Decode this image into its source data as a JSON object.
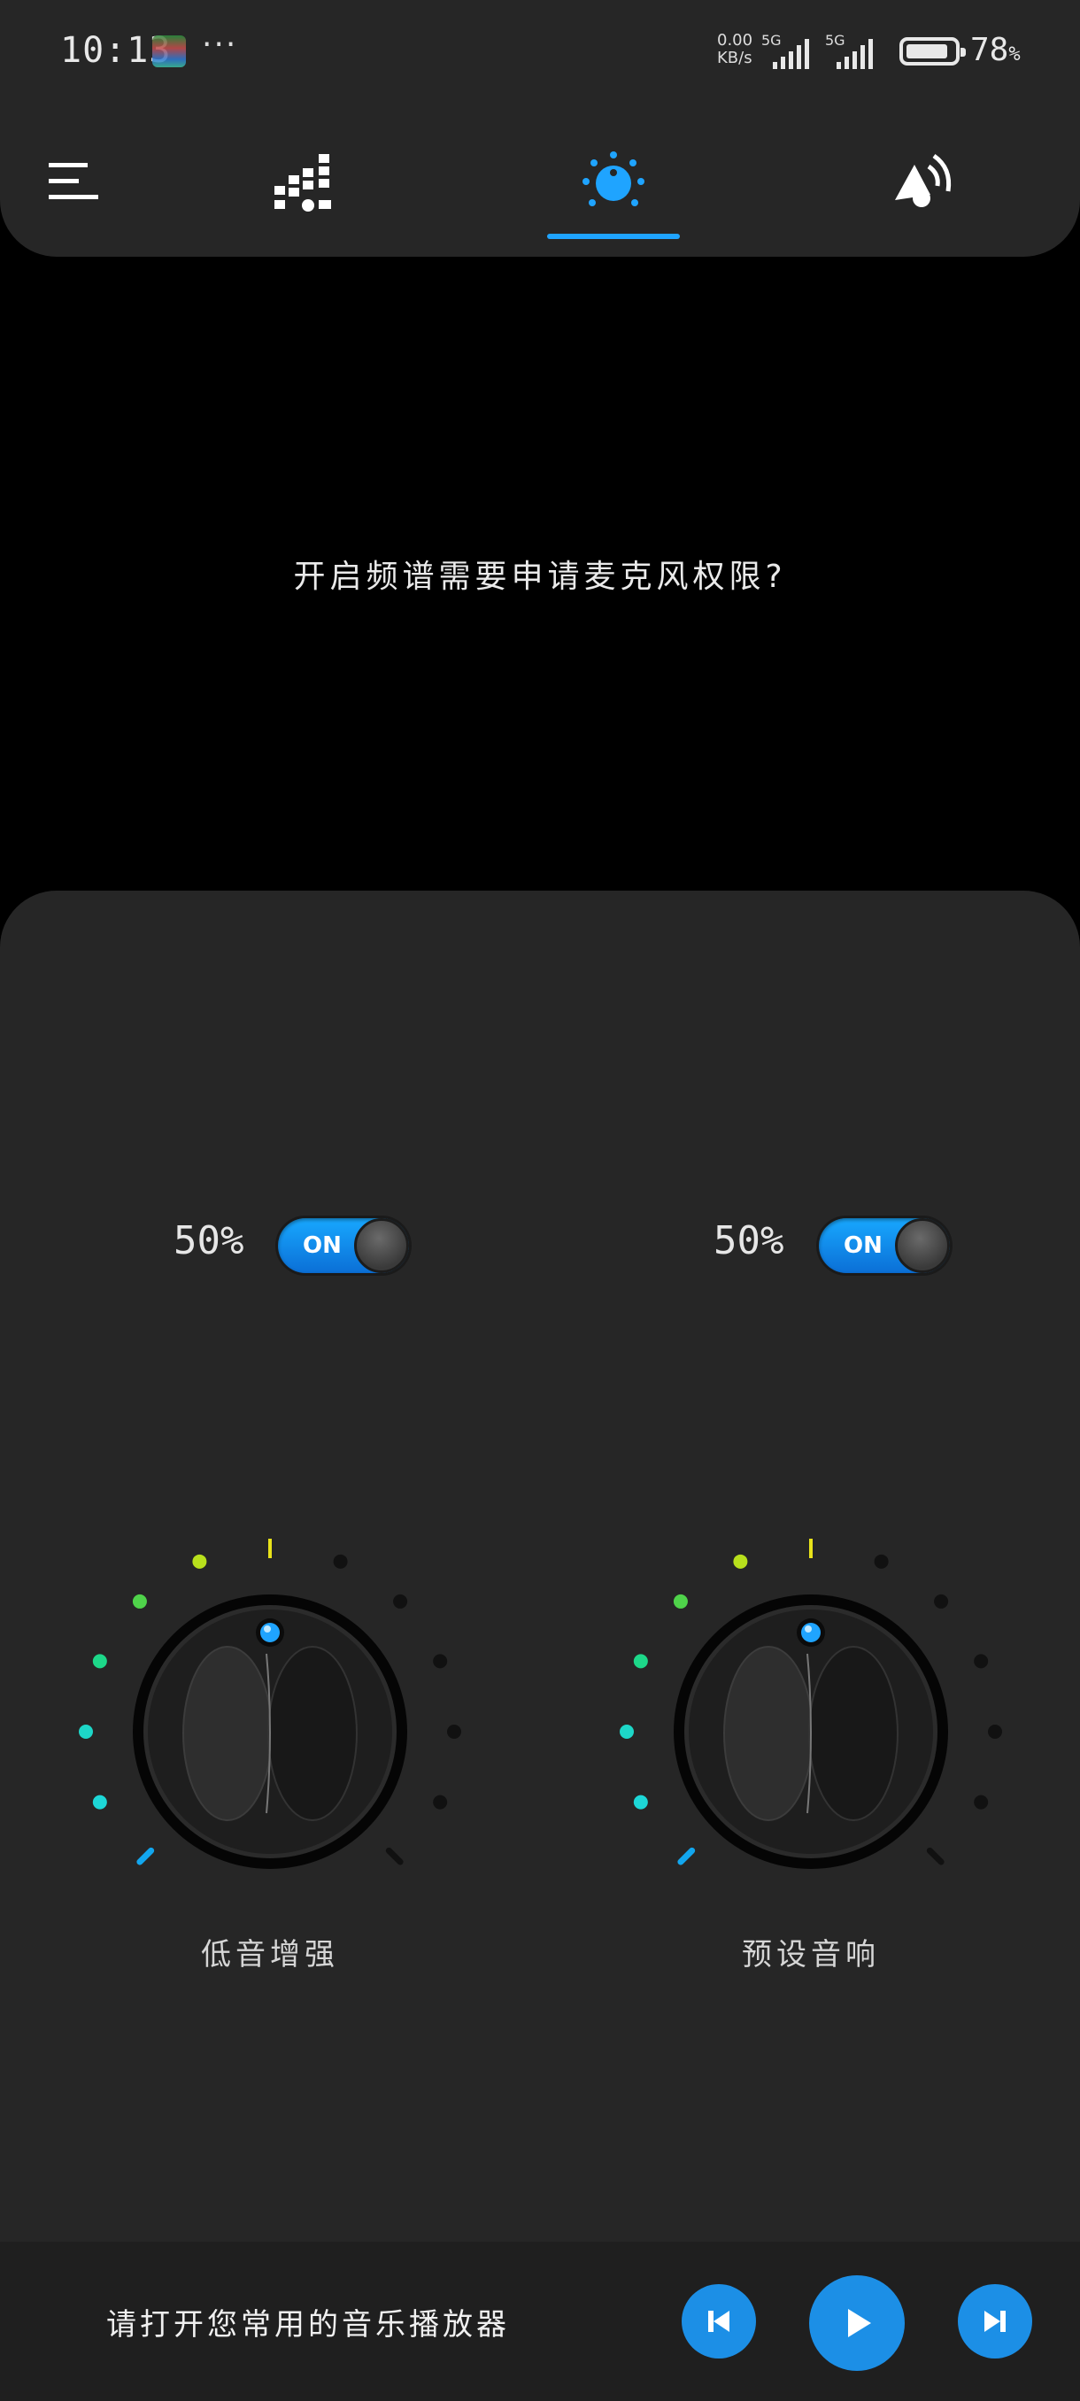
{
  "status_bar": {
    "time": "10:13",
    "more": "···",
    "net_speed_value": "0.00",
    "net_speed_unit": "KB/s",
    "sim1_label": "5G",
    "sim2_label": "5G",
    "battery_value": "78",
    "battery_unit": "%"
  },
  "nav": {
    "icons": [
      "menu-icon",
      "equalizer-icon",
      "bass-knob-icon",
      "speaker-icon"
    ],
    "active_tab": "bass-knob-icon",
    "accent_color": "#1fa4ff"
  },
  "permission_message": "开启频谱需要申请麦克风权限?",
  "controls": [
    {
      "percent": "50%",
      "toggle_label": "ON",
      "toggle_state": "on",
      "knob_label": "低音增强",
      "knob_value_fraction": 0.5
    },
    {
      "percent": "50%",
      "toggle_label": "ON",
      "toggle_state": "on",
      "knob_label": "预设音响",
      "knob_value_fraction": 0.5
    }
  ],
  "player": {
    "message": "请打开您常用的音乐播放器",
    "buttons": [
      "previous-icon",
      "play-icon",
      "next-icon"
    ]
  }
}
